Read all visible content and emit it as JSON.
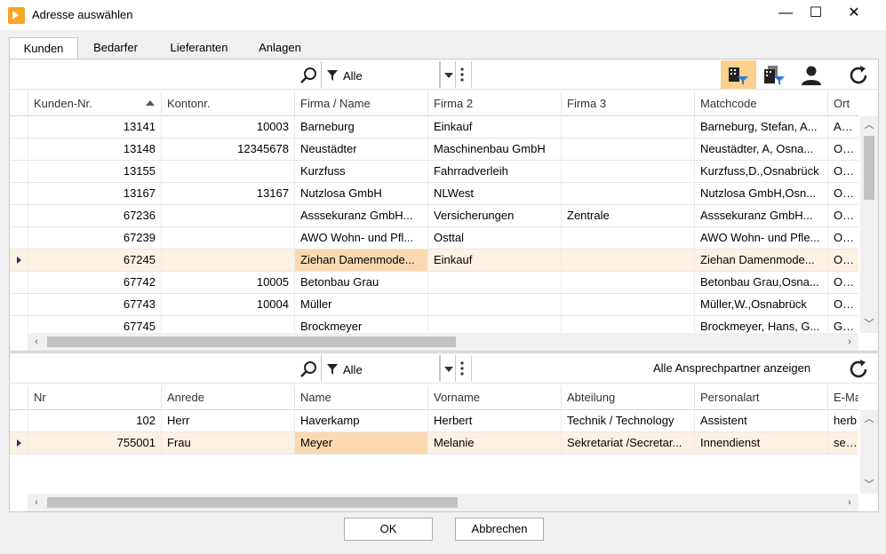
{
  "window": {
    "title": "Adresse auswählen",
    "minimize": "—",
    "maximize": "☐",
    "close": "✕"
  },
  "tabs": [
    "Kunden",
    "Bedarfer",
    "Lieferanten",
    "Anlagen"
  ],
  "top_panel": {
    "filter_value": "Alle",
    "columns": [
      "Kunden-Nr.",
      "Kontonr.",
      "Firma / Name",
      "Firma 2",
      "Firma 3",
      "Matchcode",
      "Ort"
    ],
    "rows": [
      [
        "13141",
        "10003",
        "Barneburg",
        "Einkauf",
        "",
        "Barneburg, Stefan, A...",
        "Aach"
      ],
      [
        "13148",
        "12345678",
        "Neustädter",
        "Maschinenbau GmbH",
        "",
        "Neustädter, A, Osna...",
        "Osna"
      ],
      [
        "13155",
        "",
        "Kurzfuss",
        "Fahrradverleih",
        "",
        "Kurzfuss,D.,Osnabrück",
        "Osna"
      ],
      [
        "13167",
        "13167",
        "Nutzlosa GmbH",
        "NLWest",
        "",
        "Nutzlosa GmbH,Osn...",
        "Osna"
      ],
      [
        "67236",
        "",
        "Asssekuranz GmbH...",
        "Versicherungen",
        "Zentrale",
        "Asssekuranz GmbH...",
        "Osna"
      ],
      [
        "67239",
        "",
        "AWO Wohn- und Pfl...",
        "Osttal",
        "",
        "AWO Wohn- und Pfle...",
        "Osna"
      ],
      [
        "67245",
        "",
        "Ziehan Damenmode...",
        "Einkauf",
        "",
        "Ziehan Damenmode...",
        "Osna"
      ],
      [
        "67742",
        "10005",
        "Betonbau Grau",
        "",
        "",
        "Betonbau Grau,Osna...",
        "Osna"
      ],
      [
        "67743",
        "10004",
        "Müller",
        "",
        "",
        "Müller,W.,Osnabrück",
        "Osna"
      ],
      [
        "67745",
        "",
        "Brockmeyer",
        "",
        "",
        "Brockmeyer, Hans, G...",
        "Geor"
      ]
    ],
    "selected_row": 6
  },
  "bottom_panel": {
    "filter_value": "Alle",
    "show_all_label": "Alle Ansprechpartner anzeigen",
    "columns": [
      "Nr",
      "Anrede",
      "Name",
      "Vorname",
      "Abteilung",
      "Personalart",
      "E-Ma"
    ],
    "rows": [
      [
        "102",
        "Herr",
        "Haverkamp",
        "Herbert",
        "Technik / Technology",
        "Assistent",
        "herb"
      ],
      [
        "755001",
        "Frau",
        "Meyer",
        "Melanie",
        "Sekretariat /Secretar...",
        "Innendienst",
        "sekre"
      ]
    ],
    "selected_row": 1
  },
  "buttons": {
    "ok": "OK",
    "cancel": "Abbrechen"
  },
  "colors": {
    "accent": "#f5a623",
    "selected_row": "#fdf1e4",
    "selected_cell": "#fbd9b0",
    "active_toggle": "#fcd08e"
  }
}
